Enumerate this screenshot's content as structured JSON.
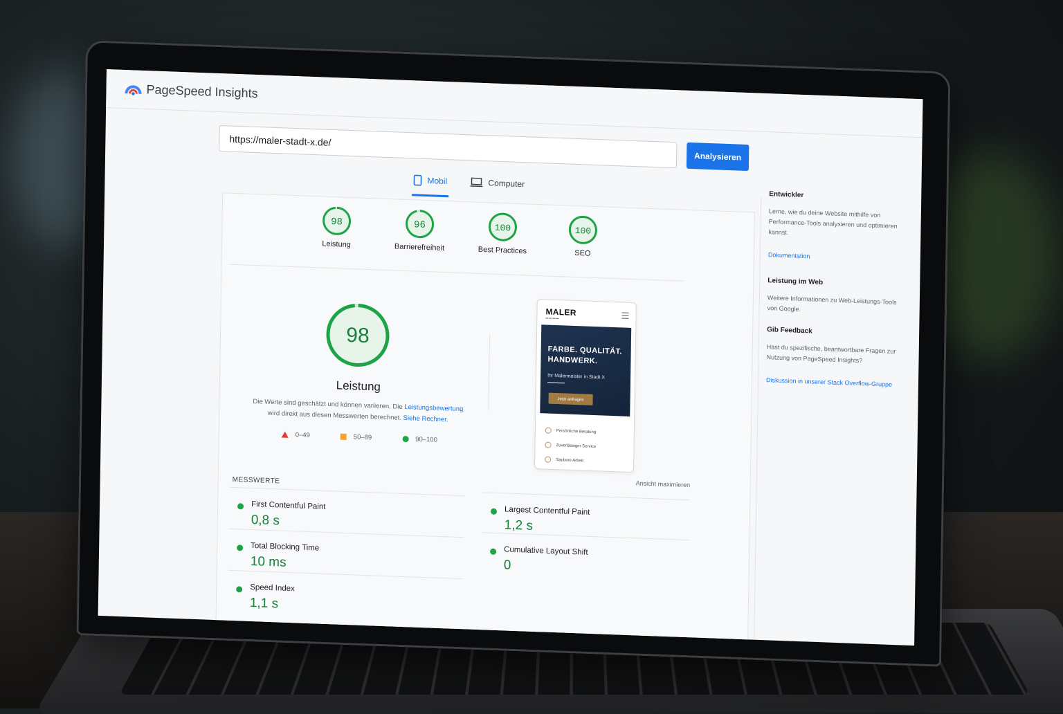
{
  "app": {
    "title": "PageSpeed Insights"
  },
  "search": {
    "url": "https://maler-stadt-x.de/",
    "button": "Analysieren"
  },
  "tabs": [
    {
      "label": "Mobil",
      "active": true
    },
    {
      "label": "Computer",
      "active": false
    }
  ],
  "scores": [
    {
      "value": 98,
      "label": "Leistung"
    },
    {
      "value": 96,
      "label": "Barrierefreiheit"
    },
    {
      "value": 100,
      "label": "Best Practices"
    },
    {
      "value": 100,
      "label": "SEO"
    }
  ],
  "performance": {
    "score": 98,
    "title": "Leistung",
    "desc_1": "Die Werte sind geschätzt und können variieren. Die",
    "desc_link_1": "Leistungsbewertung",
    "desc_2": "wird direkt aus diesen Messwerten berechnet.",
    "desc_link_2": "Siehe Rechner.",
    "legend": [
      {
        "range": "0–49",
        "color": "#e53935",
        "shape": "triangle"
      },
      {
        "range": "50–89",
        "color": "#f4a531",
        "shape": "square"
      },
      {
        "range": "90–100",
        "color": "#1ea446",
        "shape": "circle"
      }
    ]
  },
  "preview": {
    "logo": "MALER",
    "headline_1": "FARBE. QUALITÄT.",
    "headline_2": "HANDWERK.",
    "lead": "Ihr Malermeister in Stadt X",
    "cta": "Jetzt anfragen",
    "features": [
      "Persönliche Beratung",
      "Zuverlässiger Service",
      "Saubere Arbeit"
    ],
    "maximize": "Ansicht maximieren"
  },
  "metrics": {
    "label": "MESSWERTE",
    "items": [
      {
        "name": "First Contentful Paint",
        "value": "0,8 s"
      },
      {
        "name": "Largest Contentful Paint",
        "value": "1,2 s"
      },
      {
        "name": "Total Blocking Time",
        "value": "10 ms"
      },
      {
        "name": "Cumulative Layout Shift",
        "value": "0"
      },
      {
        "name": "Speed Index",
        "value": "1,1 s"
      }
    ]
  },
  "sidebar": {
    "dev_title": "Entwickler",
    "dev_text": "Lerne, wie du deine Website mithilfe von Performance-Tools analysieren und optimieren kannst.",
    "docs_link": "Dokumentation",
    "web_title": "Leistung im Web",
    "web_text": "Weitere Informationen zu Web-Leistungs-Tools von Google.",
    "feedback_title": "Gib Feedback",
    "feedback_text": "Hast du spezifische, beantwortbare Fragen zur Nutzung von PageSpeed Insights?",
    "feedback_link": "Diskussion in unserer Stack Overflow-Gruppe"
  },
  "colors": {
    "accent": "#1a73e8",
    "good": "#1ea446",
    "good_text": "#188038"
  }
}
